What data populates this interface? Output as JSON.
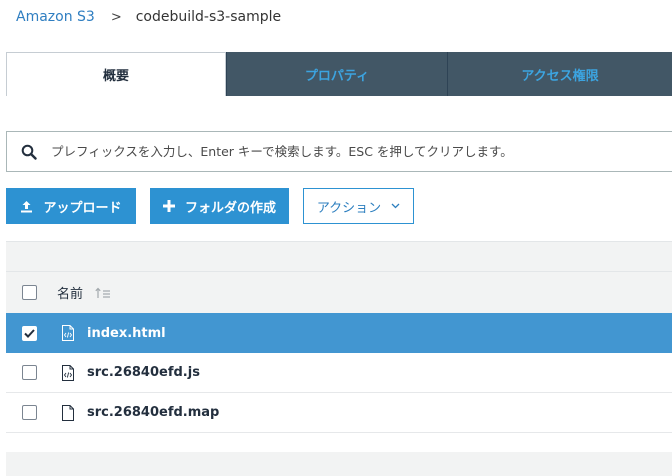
{
  "breadcrumb": {
    "root": "Amazon S3",
    "separator": ">",
    "current": "codebuild-s3-sample"
  },
  "tabs": [
    {
      "label": "概要",
      "active": true
    },
    {
      "label": "プロパティ",
      "active": false
    },
    {
      "label": "アクセス権限",
      "active": false
    }
  ],
  "search": {
    "placeholder": "プレフィックスを入力し、Enter キーで検索します。ESC を押してクリアします。"
  },
  "toolbar": {
    "upload_label": "アップロード",
    "create_folder_label": "フォルダの作成",
    "action_label": "アクション"
  },
  "table": {
    "name_header": "名前",
    "rows": [
      {
        "name": "index.html",
        "selected": true
      },
      {
        "name": "src.26840efd.js",
        "selected": false
      },
      {
        "name": "src.26840efd.map",
        "selected": false
      }
    ]
  },
  "colors": {
    "accent": "#2d92d2",
    "selected_row": "#4296d1",
    "tab_inactive_bg": "#425766",
    "tab_inactive_text": "#3ca4e0"
  }
}
